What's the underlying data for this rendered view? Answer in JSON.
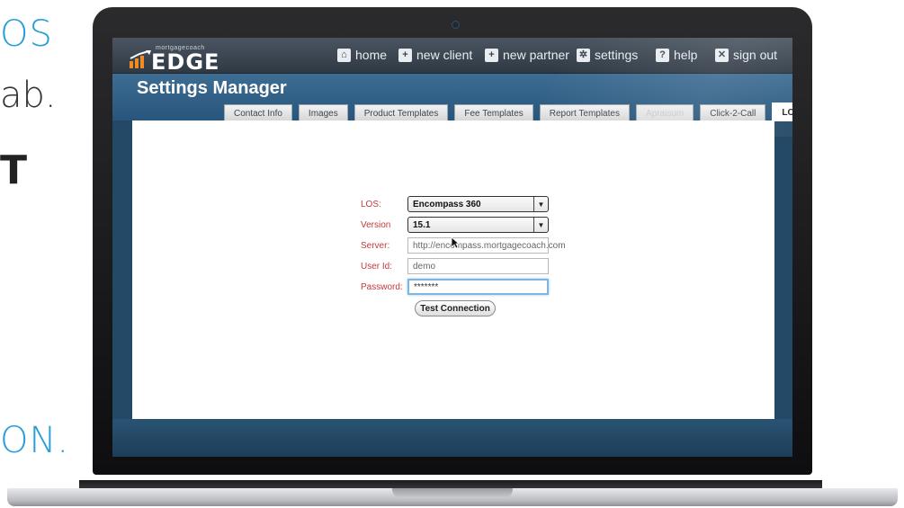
{
  "marketing": {
    "line1": "OS",
    "line2": "ab.",
    "line3": "T",
    "line4": "ON."
  },
  "app": {
    "logo_small": "mortgagecoach",
    "logo_text": "EDGE"
  },
  "nav": {
    "items": [
      {
        "label": "home",
        "icon": "home-icon"
      },
      {
        "label": "new client",
        "icon": "plus-icon"
      },
      {
        "label": "new partner",
        "icon": "plus-icon"
      },
      {
        "label": "settings",
        "icon": "gear-icon"
      },
      {
        "label": "help",
        "icon": "question-icon"
      },
      {
        "label": "sign out",
        "icon": "close-icon"
      }
    ]
  },
  "page": {
    "title": "Settings Manager"
  },
  "tabs": [
    {
      "label": "Contact Info"
    },
    {
      "label": "Images"
    },
    {
      "label": "Product Templates"
    },
    {
      "label": "Fee Templates"
    },
    {
      "label": "Report Templates"
    },
    {
      "label": "Apraisum",
      "state": "disabled"
    },
    {
      "label": "Click-2-Call"
    },
    {
      "label": "LOS Settings",
      "state": "active"
    }
  ],
  "form": {
    "los": {
      "label": "LOS:",
      "value": "Encompass 360"
    },
    "version": {
      "label": "Version",
      "value": "15.1"
    },
    "server": {
      "label": "Server:",
      "value": "http://encompass.mortgagecoach.com"
    },
    "user_id": {
      "label": "User Id:",
      "value": "demo"
    },
    "password": {
      "label": "Password:",
      "value": "*******"
    },
    "test_button": "Test Connection"
  },
  "colors": {
    "accent_blue": "#2a9fd6",
    "header_blue": "#27557b",
    "label_red": "#c43a3a"
  }
}
